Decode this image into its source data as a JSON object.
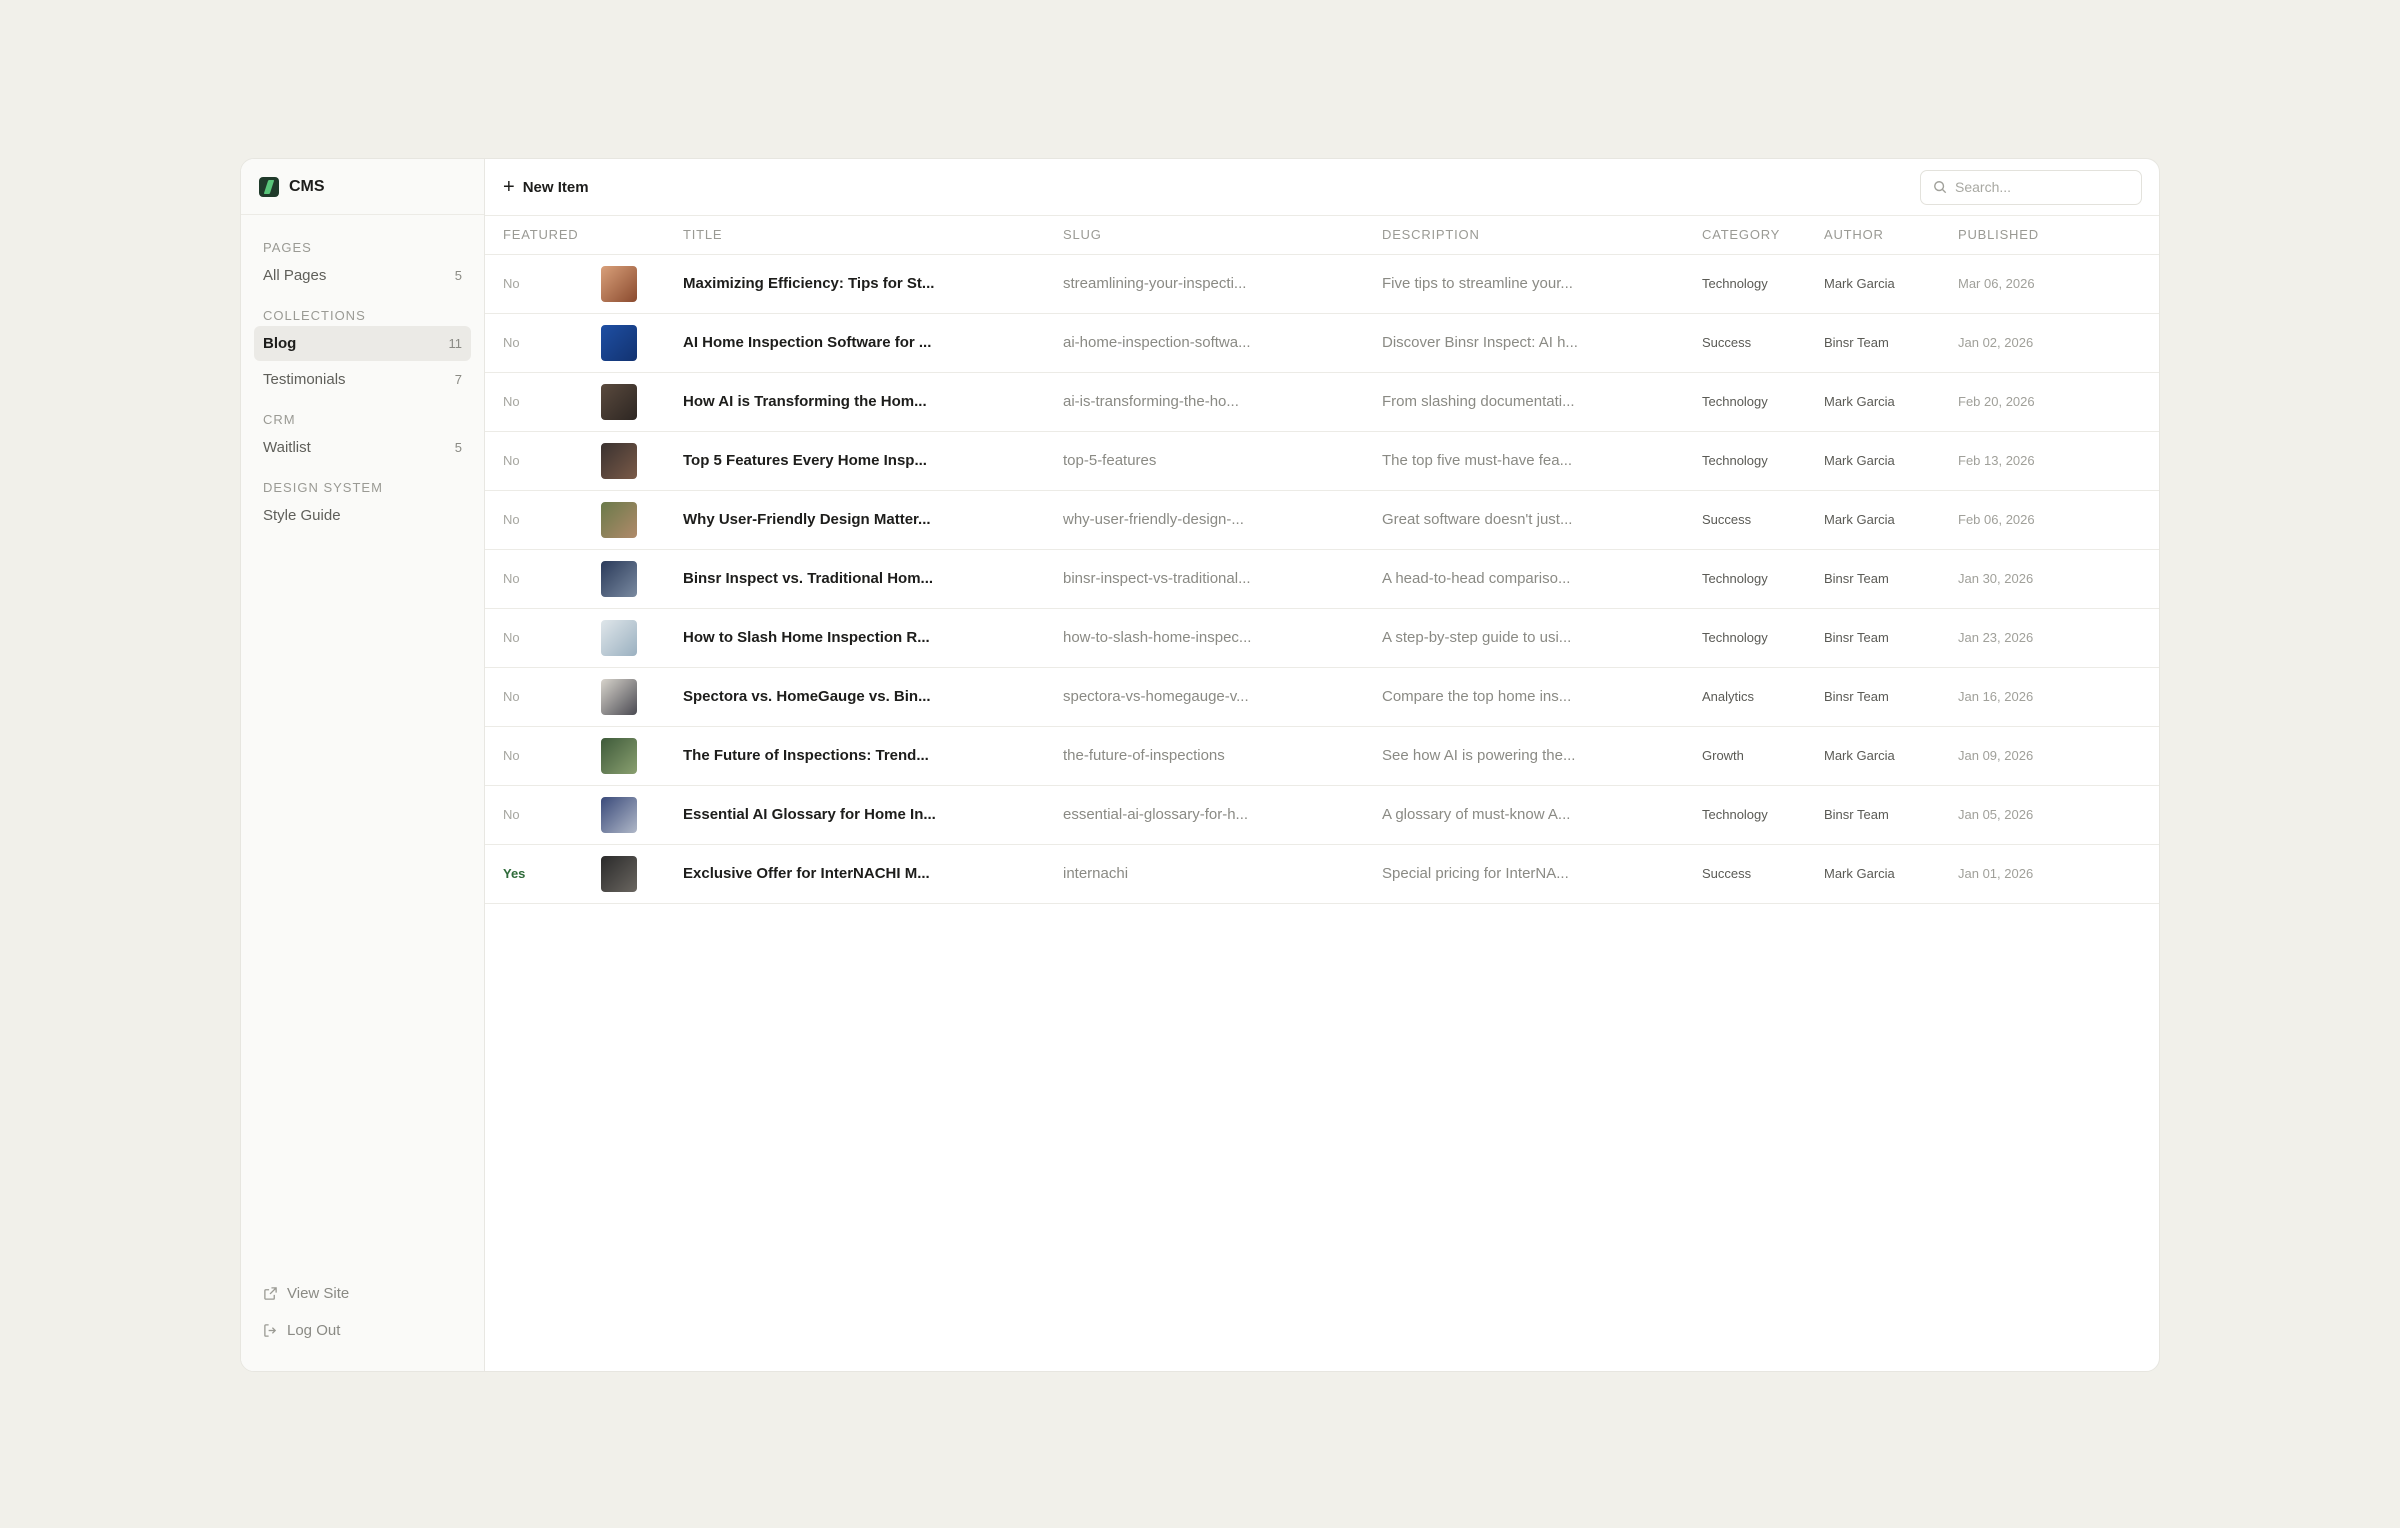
{
  "sidebar": {
    "brand": "CMS",
    "sections": [
      {
        "label": "PAGES",
        "items": [
          {
            "label": "All Pages",
            "count": "5"
          }
        ]
      },
      {
        "label": "COLLECTIONS",
        "items": [
          {
            "label": "Blog",
            "count": "11",
            "active": true
          },
          {
            "label": "Testimonials",
            "count": "7"
          }
        ]
      },
      {
        "label": "CRM",
        "items": [
          {
            "label": "Waitlist",
            "count": "5"
          }
        ]
      },
      {
        "label": "DESIGN SYSTEM",
        "items": [
          {
            "label": "Style Guide",
            "count": ""
          }
        ]
      }
    ],
    "footer": {
      "view_site": "View Site",
      "log_out": "Log Out"
    }
  },
  "toolbar": {
    "new_item_label": "New Item",
    "search_placeholder": "Search..."
  },
  "table": {
    "headers": [
      "FEATURED",
      "TITLE",
      "SLUG",
      "DESCRIPTION",
      "CATEGORY",
      "AUTHOR",
      "PUBLISHED"
    ],
    "rows": [
      {
        "featured": "No",
        "thumb": "t1",
        "title": "Maximizing Efficiency: Tips for St...",
        "slug": "streamlining-your-inspecti...",
        "description": "Five tips to streamline your...",
        "category": "Technology",
        "author": "Mark Garcia",
        "published": "Mar 06, 2026"
      },
      {
        "featured": "No",
        "thumb": "t2",
        "title": "AI Home Inspection Software for ...",
        "slug": "ai-home-inspection-softwa...",
        "description": "Discover Binsr Inspect: AI h...",
        "category": "Success",
        "author": "Binsr Team",
        "published": "Jan 02, 2026"
      },
      {
        "featured": "No",
        "thumb": "t3",
        "title": "How AI is Transforming the Hom...",
        "slug": "ai-is-transforming-the-ho...",
        "description": "From slashing documentati...",
        "category": "Technology",
        "author": "Mark Garcia",
        "published": "Feb 20, 2026"
      },
      {
        "featured": "No",
        "thumb": "t4",
        "title": "Top 5 Features Every Home Insp...",
        "slug": "top-5-features",
        "description": "The top five must-have fea...",
        "category": "Technology",
        "author": "Mark Garcia",
        "published": "Feb 13, 2026"
      },
      {
        "featured": "No",
        "thumb": "t5",
        "title": "Why User-Friendly Design Matter...",
        "slug": "why-user-friendly-design-...",
        "description": "Great software doesn't just...",
        "category": "Success",
        "author": "Mark Garcia",
        "published": "Feb 06, 2026"
      },
      {
        "featured": "No",
        "thumb": "t6",
        "title": "Binsr Inspect vs. Traditional Hom...",
        "slug": "binsr-inspect-vs-traditional...",
        "description": "A head-to-head compariso...",
        "category": "Technology",
        "author": "Binsr Team",
        "published": "Jan 30, 2026"
      },
      {
        "featured": "No",
        "thumb": "t7",
        "title": "How to Slash Home Inspection R...",
        "slug": "how-to-slash-home-inspec...",
        "description": "A step-by-step guide to usi...",
        "category": "Technology",
        "author": "Binsr Team",
        "published": "Jan 23, 2026"
      },
      {
        "featured": "No",
        "thumb": "t8",
        "title": "Spectora vs. HomeGauge vs. Bin...",
        "slug": "spectora-vs-homegauge-v...",
        "description": "Compare the top home ins...",
        "category": "Analytics",
        "author": "Binsr Team",
        "published": "Jan 16, 2026"
      },
      {
        "featured": "No",
        "thumb": "t9",
        "title": "The Future of Inspections: Trend...",
        "slug": "the-future-of-inspections",
        "description": "See how AI is powering the...",
        "category": "Growth",
        "author": "Mark Garcia",
        "published": "Jan 09, 2026"
      },
      {
        "featured": "No",
        "thumb": "t10",
        "title": "Essential AI Glossary for Home In...",
        "slug": "essential-ai-glossary-for-h...",
        "description": "A glossary of must-know A...",
        "category": "Technology",
        "author": "Binsr Team",
        "published": "Jan 05, 2026"
      },
      {
        "featured": "Yes",
        "thumb": "t11",
        "title": "Exclusive Offer for InterNACHI M...",
        "slug": "internachi",
        "description": "Special pricing for InterNA...",
        "category": "Success",
        "author": "Mark Garcia",
        "published": "Jan 01, 2026"
      }
    ]
  },
  "colors": {
    "page_bg": "#f1f0ea",
    "accent_green": "#2f6b3a",
    "active_bg": "#ebeae6"
  },
  "thumb_colors": {
    "t1": [
      "#d9a07a",
      "#8a4a2e"
    ],
    "t2": [
      "#1e4fa3",
      "#123270"
    ],
    "t3": [
      "#5a4a3e",
      "#2d2622"
    ],
    "t4": [
      "#3a3230",
      "#7a5a48"
    ],
    "t5": [
      "#6a7a4a",
      "#b08a6a"
    ],
    "t6": [
      "#2a3a5a",
      "#7a8aa0"
    ],
    "t7": [
      "#dfe6ea",
      "#9ab0c0"
    ],
    "t8": [
      "#d8d4cc",
      "#4a4a52"
    ],
    "t9": [
      "#3e5a3a",
      "#8aa070"
    ],
    "t10": [
      "#3a4a7a",
      "#b0b8c8"
    ],
    "t11": [
      "#2a2a2a",
      "#6a6660"
    ]
  }
}
